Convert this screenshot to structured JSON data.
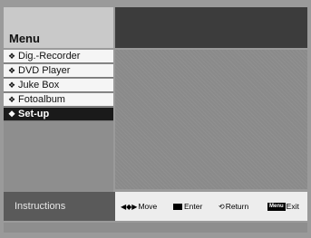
{
  "menu": {
    "title": "Menu",
    "items": [
      {
        "label": "Dig.-Recorder",
        "icon": "diamond-bullet-icon",
        "selected": false
      },
      {
        "label": "DVD Player",
        "icon": "diamond-bullet-icon",
        "selected": false
      },
      {
        "label": "Juke Box",
        "icon": "diamond-bullet-icon",
        "selected": false
      },
      {
        "label": "Fotoalbum",
        "icon": "diamond-bullet-icon",
        "selected": false
      },
      {
        "label": "Set-up",
        "icon": "diamond-bullet-icon",
        "selected": true
      }
    ]
  },
  "instructions": {
    "label": "Instructions",
    "move": {
      "label": "Move",
      "icon": "left-right-arrows-icon"
    },
    "enter": {
      "label": "Enter",
      "icon": "enter-key-icon"
    },
    "return": {
      "label": "Return",
      "icon": "return-circle-icon"
    },
    "exit": {
      "label": "Exit",
      "icon": "menu-key-icon",
      "key_text": "Menu"
    }
  },
  "colors": {
    "background": "#9a9a9a",
    "header_right": "#3c3c3c",
    "selected_item": "#1a1a1a",
    "item_bg": "#f5f5f5",
    "instructions_bar": "#5a5a5a"
  }
}
